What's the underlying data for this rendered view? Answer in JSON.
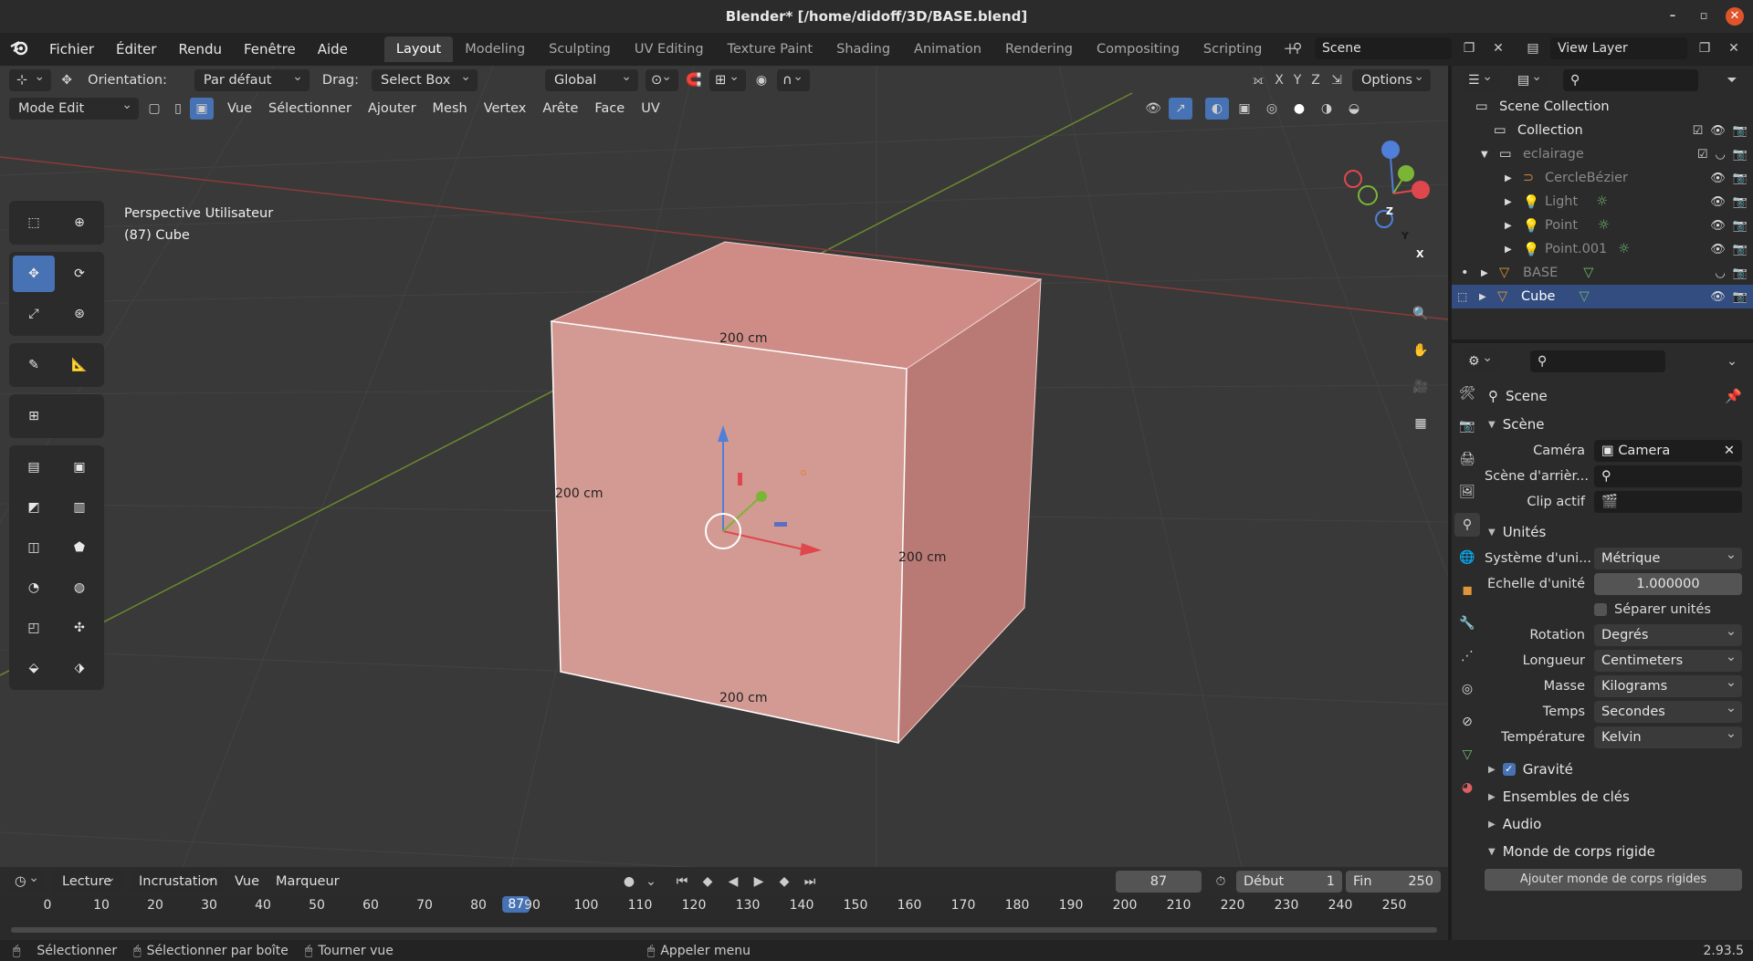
{
  "window": {
    "title": "Blender* [/home/didoff/3D/BASE.blend]"
  },
  "menubar": {
    "items": [
      "Fichier",
      "Éditer",
      "Rendu",
      "Fenêtre",
      "Aide"
    ],
    "tabs": [
      "Layout",
      "Modeling",
      "Sculpting",
      "UV Editing",
      "Texture Paint",
      "Shading",
      "Animation",
      "Rendering",
      "Compositing",
      "Scripting"
    ],
    "active_tab": "Layout",
    "scene": "Scene",
    "view_layer": "View Layer"
  },
  "viewport": {
    "orientation_label": "Orientation:",
    "orientation_value": "Par défaut",
    "drag_label": "Drag:",
    "drag_value": "Select Box",
    "transform_space": "Global",
    "axis_x": "X",
    "axis_y": "Y",
    "axis_z": "Z",
    "options": "Options",
    "mode": "Mode Edit",
    "menus": [
      "Vue",
      "Sélectionner",
      "Ajouter",
      "Mesh",
      "Vertex",
      "Arête",
      "Face",
      "UV"
    ],
    "info_line1": "Perspective Utilisateur",
    "info_line2": "(87) Cube",
    "dims": {
      "top": "200 cm",
      "left": "200 cm",
      "right": "200 cm",
      "bottom": "200 cm"
    },
    "gizmo": {
      "z": "Z",
      "y": "Y",
      "x": "X"
    }
  },
  "timeline": {
    "playback": "Lecture",
    "keying": "Incrustation",
    "view": "Vue",
    "marker": "Marqueur",
    "current_frame": "87",
    "start_label": "Début",
    "start": "1",
    "end_label": "Fin",
    "end": "250",
    "ticks": [
      "0",
      "10",
      "20",
      "30",
      "40",
      "50",
      "60",
      "70",
      "80",
      "90",
      "100",
      "110",
      "120",
      "130",
      "140",
      "150",
      "160",
      "170",
      "180",
      "190",
      "200",
      "210",
      "220",
      "230",
      "240",
      "250"
    ],
    "ruler_frame": "87"
  },
  "status": {
    "select": "Sélectionner",
    "box": "Sélectionner par boîte",
    "rotate": "Tourner vue",
    "menu": "Appeler menu",
    "version": "2.93.5"
  },
  "outliner": {
    "rows": [
      {
        "name": "Scene Collection",
        "indent": 0
      },
      {
        "name": "Collection",
        "indent": 1
      },
      {
        "name": "eclairage",
        "indent": 1
      },
      {
        "name": "CercleBézier",
        "indent": 2
      },
      {
        "name": "Light",
        "indent": 2
      },
      {
        "name": "Point",
        "indent": 2
      },
      {
        "name": "Point.001",
        "indent": 2
      },
      {
        "name": "BASE",
        "indent": 1
      },
      {
        "name": "Cube",
        "indent": 1
      }
    ]
  },
  "properties": {
    "context": "Scene",
    "scene_section": "Scène",
    "camera_label": "Caméra",
    "camera_value": "Camera",
    "bg_label": "Scène d'arrièr...",
    "clip_label": "Clip actif",
    "units_section": "Unités",
    "unit_system_label": "Système d'uni...",
    "unit_system": "Métrique",
    "unit_scale_label": "Échelle d'unité",
    "unit_scale": "1.000000",
    "separate_units": "Séparer unités",
    "rotation_label": "Rotation",
    "rotation": "Degrés",
    "length_label": "Longueur",
    "length": "Centimeters",
    "mass_label": "Masse",
    "mass": "Kilograms",
    "time_label": "Temps",
    "time": "Secondes",
    "temp_label": "Température",
    "temp": "Kelvin",
    "gravity": "Gravité",
    "keying_sets": "Ensembles de clés",
    "audio": "Audio",
    "rigid_world": "Monde de corps rigide",
    "add_rigid": "Ajouter monde de corps rigides"
  },
  "colors": {
    "accent": "#4772b3",
    "selected_row": "#334d80",
    "viewport_bg": "#393939",
    "cube_face": "#d4918a"
  }
}
